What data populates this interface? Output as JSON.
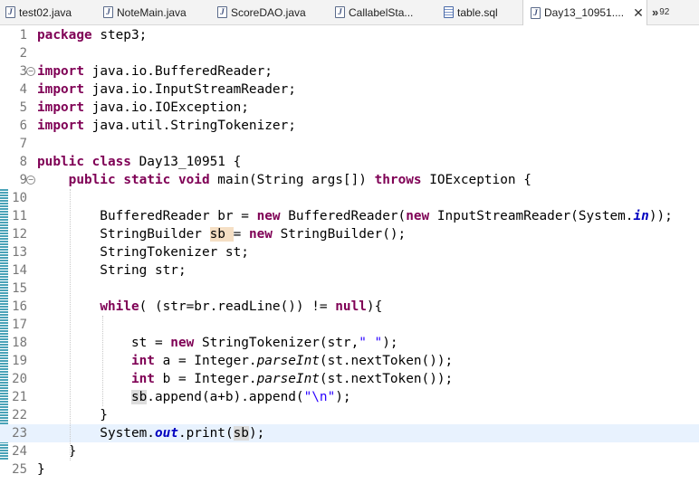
{
  "tabs": [
    {
      "label": "test02.java",
      "icon": "java-file-icon",
      "active": false
    },
    {
      "label": "NoteMain.java",
      "icon": "java-file-icon",
      "active": false
    },
    {
      "label": "ScoreDAO.java",
      "icon": "java-file-icon",
      "active": false
    },
    {
      "label": "CallabelSta...",
      "icon": "java-file-icon",
      "active": false
    },
    {
      "label": "table.sql",
      "icon": "sql-file-icon",
      "active": false
    },
    {
      "label": "Day13_10951....",
      "icon": "java-file-icon",
      "active": true
    }
  ],
  "overflow": {
    "count": "92"
  },
  "editor": {
    "lines": [
      {
        "num": "1",
        "tokens": [
          [
            "kw",
            "package"
          ],
          [
            "",
            "step3;"
          ]
        ]
      },
      {
        "num": "2",
        "tokens": []
      },
      {
        "num": "3",
        "fold": true,
        "tokens": [
          [
            "kw",
            "import"
          ],
          [
            "",
            "java.io.BufferedReader;"
          ]
        ]
      },
      {
        "num": "4",
        "tokens": [
          [
            "kw",
            "import"
          ],
          [
            "",
            "java.io.InputStreamReader;"
          ]
        ]
      },
      {
        "num": "5",
        "tokens": [
          [
            "kw",
            "import"
          ],
          [
            "",
            "java.io.IOException;"
          ]
        ]
      },
      {
        "num": "6",
        "tokens": [
          [
            "kw",
            "import"
          ],
          [
            "",
            "java.util.StringTokenizer;"
          ]
        ]
      },
      {
        "num": "7",
        "tokens": []
      },
      {
        "num": "8",
        "tokens": [
          [
            "kw",
            "public"
          ],
          [
            "",
            ""
          ],
          [
            "kw",
            "class"
          ],
          [
            "",
            "Day13_10951 {"
          ]
        ]
      },
      {
        "num": "9",
        "fold": true,
        "tokens": [
          [
            "",
            "    "
          ],
          [
            "kw",
            "public"
          ],
          [
            "",
            ""
          ],
          [
            "kw",
            "static"
          ],
          [
            "",
            ""
          ],
          [
            "kw",
            "void"
          ],
          [
            "",
            "main(String args[]) "
          ],
          [
            "kw",
            "throws"
          ],
          [
            "",
            "IOException {"
          ]
        ]
      },
      {
        "num": "10",
        "tokens": []
      },
      {
        "num": "11",
        "tokens": [
          [
            "",
            "        BufferedReader br = "
          ],
          [
            "kw",
            "new"
          ],
          [
            "",
            "BufferedReader("
          ],
          [
            "kw",
            "new"
          ],
          [
            "",
            "InputStreamReader(System."
          ],
          [
            "fld",
            "in"
          ],
          [
            "",
            "));"
          ]
        ]
      },
      {
        "num": "12",
        "tokens": [
          [
            "",
            "        StringBuilder "
          ],
          [
            "hl1",
            "sb"
          ],
          [
            "",
            "= "
          ],
          [
            "kw",
            "new"
          ],
          [
            "",
            "StringBuilder();"
          ]
        ]
      },
      {
        "num": "13",
        "tokens": [
          [
            "",
            "        StringTokenizer st;"
          ]
        ]
      },
      {
        "num": "14",
        "tokens": [
          [
            "",
            "        String str;"
          ]
        ]
      },
      {
        "num": "15",
        "tokens": []
      },
      {
        "num": "16",
        "tokens": [
          [
            "",
            "        "
          ],
          [
            "kw",
            "while"
          ],
          [
            "",
            "( (str=br.readLine()) != "
          ],
          [
            "kw",
            "null"
          ],
          [
            "",
            "){"
          ]
        ]
      },
      {
        "num": "17",
        "tokens": []
      },
      {
        "num": "18",
        "tokens": [
          [
            "",
            "            st = "
          ],
          [
            "kw",
            "new"
          ],
          [
            "",
            "StringTokenizer(str,"
          ],
          [
            "str",
            "\" \""
          ],
          [
            "",
            ");"
          ]
        ]
      },
      {
        "num": "19",
        "tokens": [
          [
            "",
            "            "
          ],
          [
            "kw",
            "int"
          ],
          [
            "",
            "a = Integer."
          ],
          [
            "mth",
            "parseInt"
          ],
          [
            "",
            "(st.nextToken());"
          ]
        ]
      },
      {
        "num": "20",
        "tokens": [
          [
            "",
            "            "
          ],
          [
            "kw",
            "int"
          ],
          [
            "",
            "b = Integer."
          ],
          [
            "mth",
            "parseInt"
          ],
          [
            "",
            "(st.nextToken());"
          ]
        ]
      },
      {
        "num": "21",
        "tokens": [
          [
            "",
            "            "
          ],
          [
            "hl2",
            "sb"
          ],
          [
            "",
            ".append(a+b).append("
          ],
          [
            "str",
            "\"\\n\""
          ],
          [
            "",
            ");"
          ]
        ]
      },
      {
        "num": "22",
        "tokens": [
          [
            "",
            "        }"
          ]
        ]
      },
      {
        "num": "23",
        "current": true,
        "tokens": [
          [
            "",
            "        System."
          ],
          [
            "fld",
            "out"
          ],
          [
            "",
            ".print("
          ],
          [
            "hl2",
            "sb"
          ],
          [
            "",
            ");"
          ]
        ]
      },
      {
        "num": "24",
        "tokens": [
          [
            "",
            "    }"
          ]
        ]
      },
      {
        "num": "25",
        "tokens": [
          [
            "",
            "}"
          ]
        ]
      }
    ]
  }
}
